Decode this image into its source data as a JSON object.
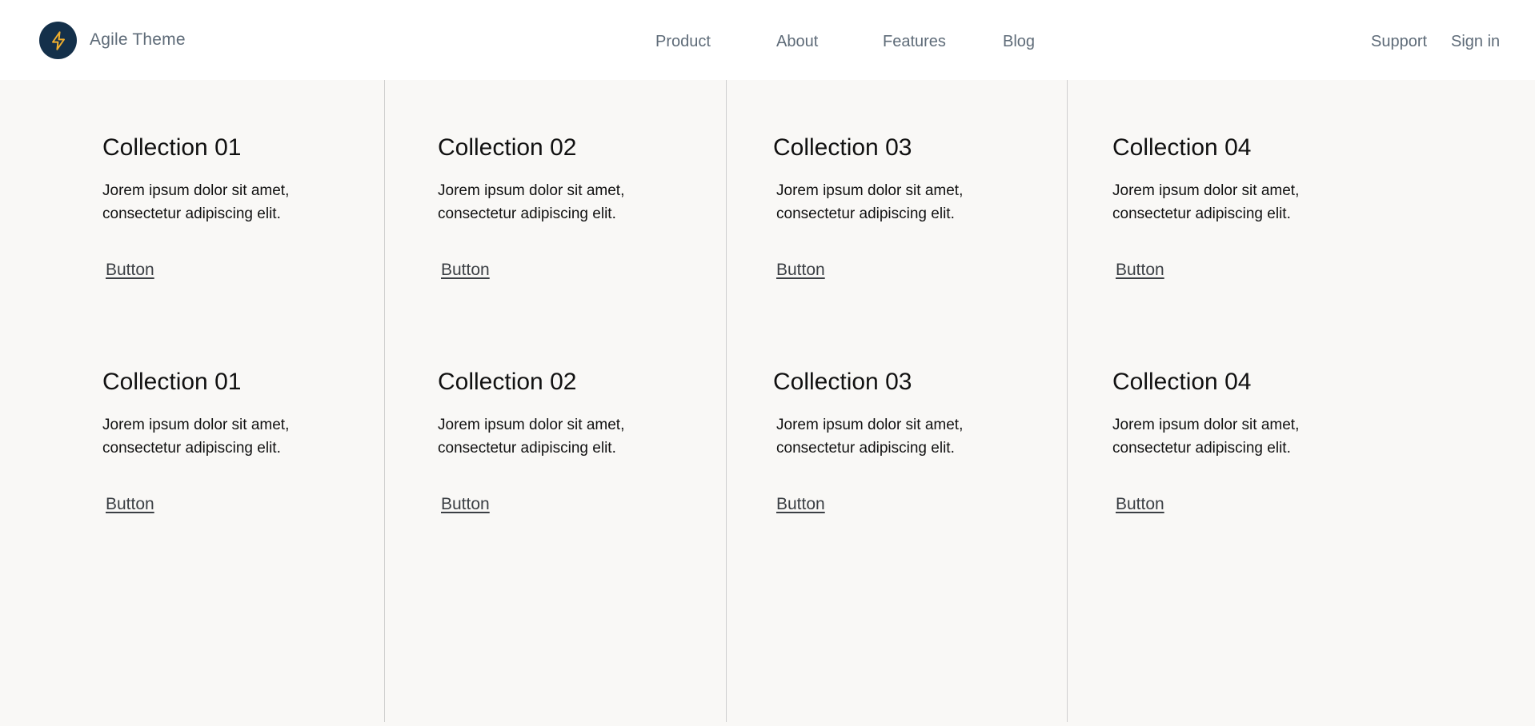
{
  "header": {
    "brand_name": "Agile Theme",
    "logo_icon": "lightning-bolt-icon",
    "nav": [
      "Product",
      "About",
      "Features",
      "Blog"
    ],
    "support_label": "Support",
    "signin_label": "Sign in"
  },
  "colors": {
    "logo_bg": "#14304a",
    "logo_bolt": "#f2b02e",
    "nav_text": "#5e6b78",
    "content_bg": "#f9f8f6",
    "divider": "#cfcfcf"
  },
  "rows": [
    {
      "cards": [
        {
          "title": "Collection 01",
          "desc": "Jorem ipsum dolor sit amet, consectetur adipiscing elit.",
          "button": "Button"
        },
        {
          "title": "Collection 02",
          "desc": "Jorem ipsum dolor sit amet, consectetur adipiscing elit.",
          "button": "Button"
        },
        {
          "title": "Collection 03",
          "desc": "Jorem ipsum dolor sit amet, consectetur adipiscing elit.",
          "button": "Button"
        },
        {
          "title": "Collection 04",
          "desc": "Jorem ipsum dolor sit amet, consectetur adipiscing elit.",
          "button": "Button"
        }
      ]
    },
    {
      "cards": [
        {
          "title": "Collection 01",
          "desc": "Jorem ipsum dolor sit amet, consectetur adipiscing elit.",
          "button": "Button"
        },
        {
          "title": "Collection 02",
          "desc": "Jorem ipsum dolor sit amet, consectetur adipiscing elit.",
          "button": "Button"
        },
        {
          "title": "Collection 03",
          "desc": "Jorem ipsum dolor sit amet, consectetur adipiscing elit.",
          "button": "Button"
        },
        {
          "title": "Collection 04",
          "desc": "Jorem ipsum dolor sit amet, consectetur adipiscing elit.",
          "button": "Button"
        }
      ]
    }
  ]
}
